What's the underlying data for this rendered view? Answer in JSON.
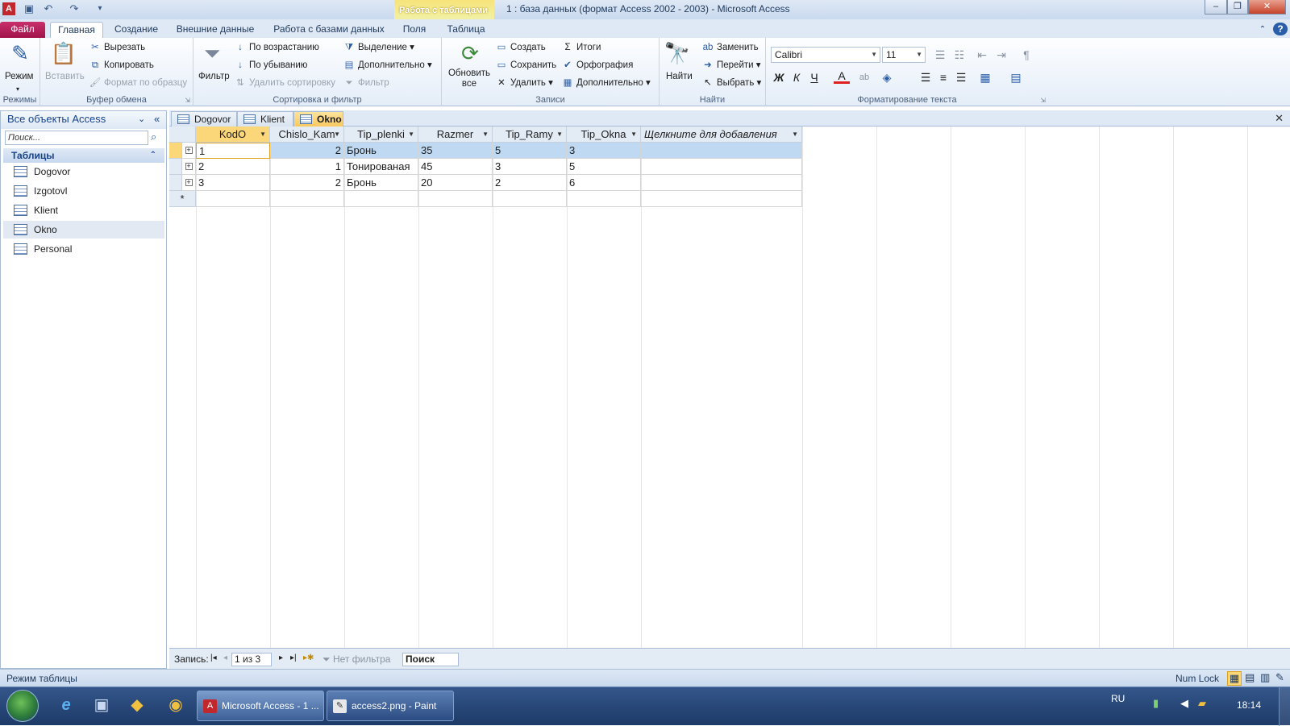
{
  "window": {
    "title": "1 : база данных (формат Access 2002 - 2003)  -  Microsoft Access",
    "contextual_tab_group": "Работа с таблицами"
  },
  "ribbon_tabs": [
    "Файл",
    "Главная",
    "Создание",
    "Внешние данные",
    "Работа с базами данных",
    "Поля",
    "Таблица"
  ],
  "ribbon": {
    "views": {
      "mode": "Режим",
      "group": "Режимы"
    },
    "clipboard": {
      "paste": "Вставить",
      "cut": "Вырезать",
      "copy": "Копировать",
      "format_painter": "Формат по образцу",
      "group": "Буфер обмена"
    },
    "sort_filter": {
      "filter": "Фильтр",
      "ascending": "По возрастанию",
      "descending": "По убыванию",
      "remove_sort": "Удалить сортировку",
      "selection": "Выделение",
      "advanced": "Дополнительно",
      "toggle_filter": "Фильтр",
      "group": "Сортировка и фильтр"
    },
    "records": {
      "refresh": "Обновить все",
      "new": "Создать",
      "save": "Сохранить",
      "delete": "Удалить",
      "totals": "Итоги",
      "spelling": "Орфография",
      "more": "Дополнительно",
      "group": "Записи"
    },
    "find": {
      "find": "Найти",
      "replace": "Заменить",
      "goto": "Перейти",
      "select": "Выбрать",
      "group": "Найти"
    },
    "text_formatting": {
      "font": "Calibri",
      "size": "11",
      "bold": "Ж",
      "italic": "К",
      "underline": "Ч",
      "group": "Форматирование текста"
    }
  },
  "nav_pane": {
    "header": "Все объекты Access",
    "search_placeholder": "Поиск...",
    "group": "Таблицы",
    "items": [
      "Dogovor",
      "Izgotovl",
      "Klient",
      "Okno",
      "Personal"
    ],
    "selected": "Okno"
  },
  "doc_tabs": [
    {
      "label": "Dogovor",
      "active": false
    },
    {
      "label": "Klient",
      "active": false
    },
    {
      "label": "Okno",
      "active": true
    }
  ],
  "table": {
    "columns": [
      "KodO",
      "Chislo_Kam",
      "Tip_plenki",
      "Razmer",
      "Tip_Ramy",
      "Tip_Okna",
      "Щелкните для добавления"
    ],
    "rows": [
      [
        "1",
        "2",
        "Бронь",
        "35",
        "5",
        "3",
        ""
      ],
      [
        "2",
        "1",
        "Тонированая",
        "45",
        "3",
        "5",
        ""
      ],
      [
        "3",
        "2",
        "Бронь",
        "20",
        "2",
        "6",
        ""
      ]
    ],
    "new_row_marker": "*"
  },
  "record_nav": {
    "label": "Запись:",
    "position": "1 из 3",
    "filter_status": "Нет фильтра",
    "search": "Поиск"
  },
  "status_bar": {
    "left": "Режим таблицы",
    "num_lock": "Num Lock"
  },
  "taskbar": {
    "tasks": [
      "Microsoft Access - 1 ...",
      "access2.png - Paint"
    ],
    "lang": "RU",
    "time": "18:14"
  }
}
